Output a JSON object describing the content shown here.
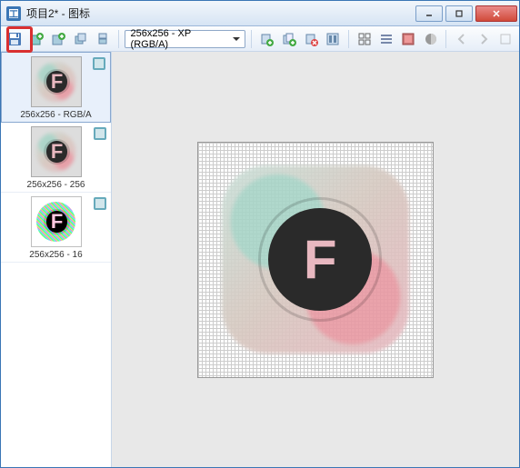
{
  "window": {
    "title": "项目2* - 图标"
  },
  "toolbar": {
    "size_selector": "256x256 - XP (RGB/A)"
  },
  "sidebar": {
    "items": [
      {
        "label": "256x256 - RGB/A"
      },
      {
        "label": "256x256 - 256"
      },
      {
        "label": "256x256 - 16"
      }
    ]
  },
  "icons": {
    "save": "save-icon",
    "add_green": "add-icon",
    "add_blue": "add-icon",
    "layers1": "layers-icon",
    "layers2": "layers-icon",
    "import": "import-icon",
    "import2": "import-icon",
    "delete": "delete-icon",
    "props": "props-icon",
    "grid": "grid-icon",
    "list": "list-icon",
    "tile": "tile-icon",
    "gray": "gray-icon",
    "prev": "prev-icon",
    "next": "next-icon",
    "expand": "expand-icon"
  }
}
